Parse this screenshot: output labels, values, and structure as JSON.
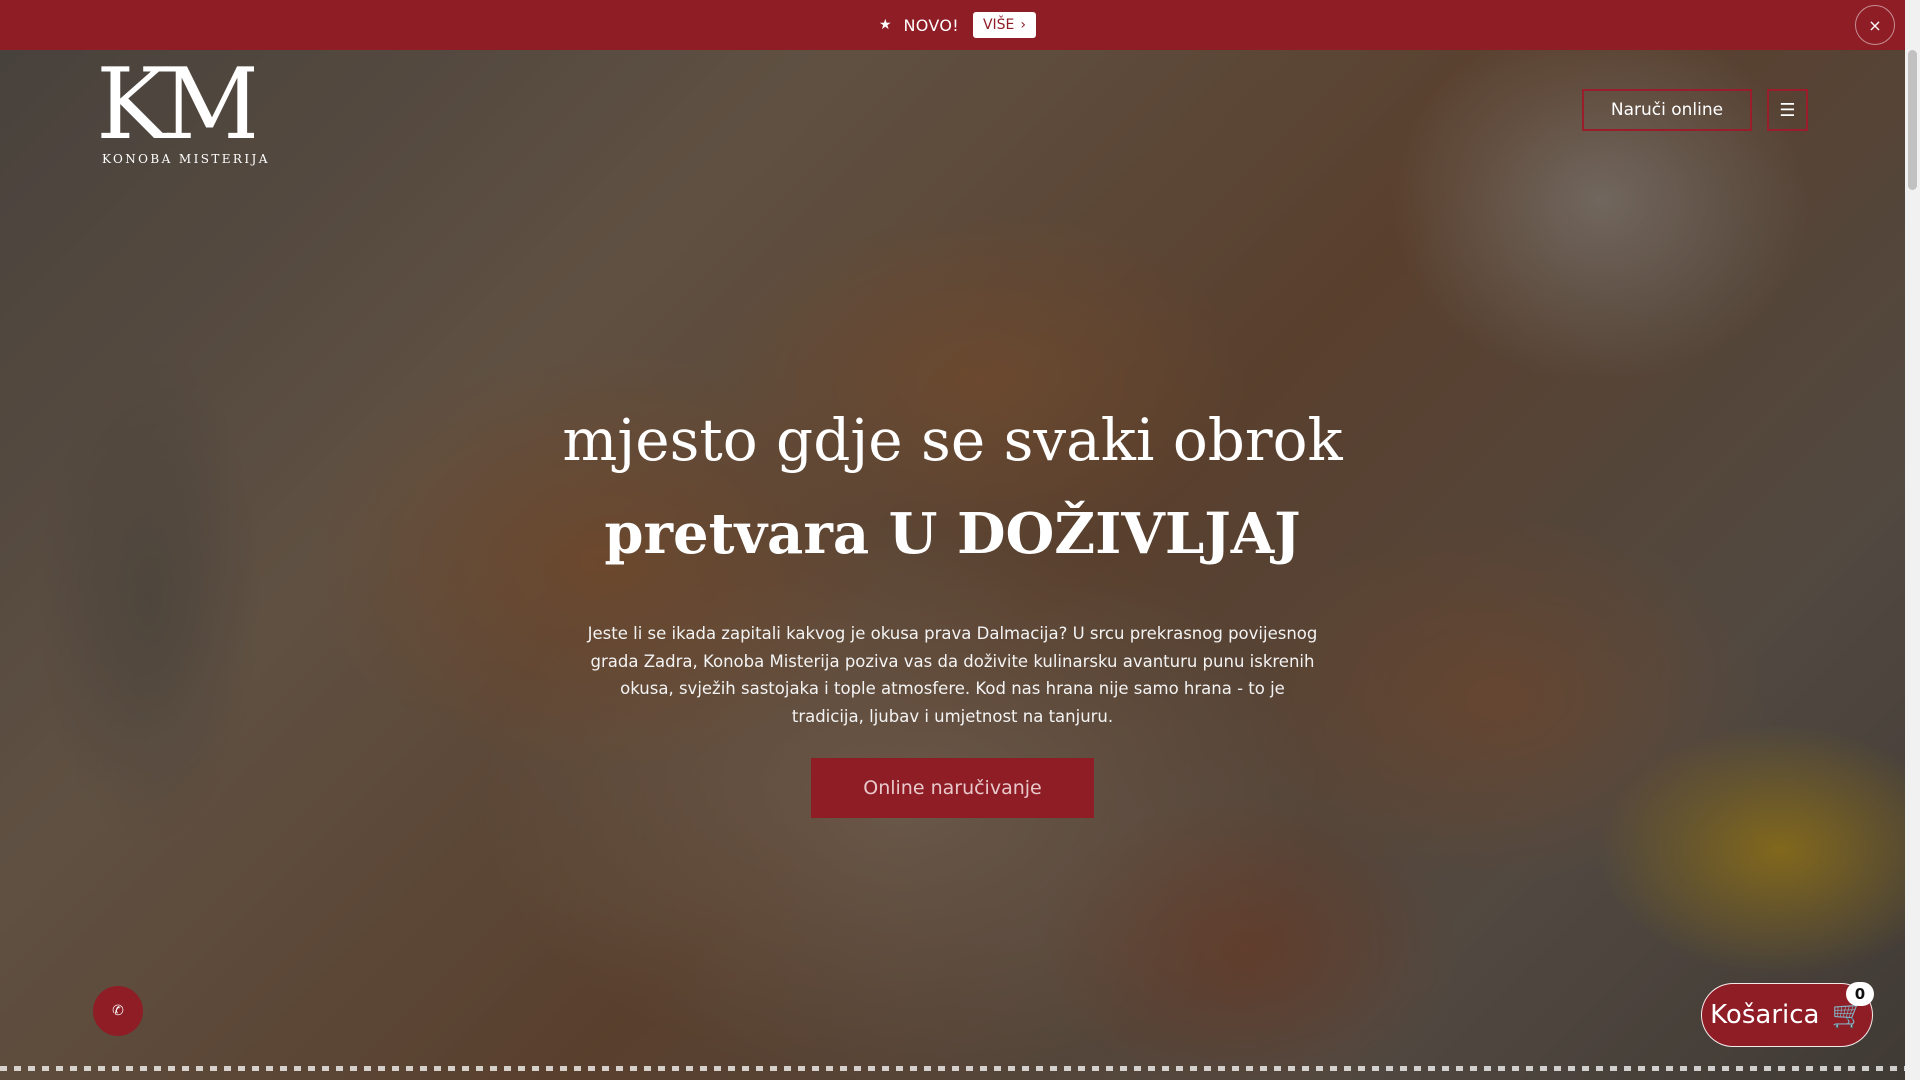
{
  "announcement": {
    "icon": "megaphone-icon",
    "label": "NOVO!",
    "more_label": "VIŠE",
    "close_label": "×"
  },
  "logo": {
    "letters": "KM",
    "tagline": "KONOBA MISTERIJA"
  },
  "header": {
    "order_button": "Naruči online",
    "menu_icon": "menu-icon"
  },
  "hero": {
    "line1": "mjesto gdje se svaki obrok",
    "line2": "pretvara U DOŽIVLJAJ",
    "description": "Jeste li se ikada zapitali kakvog je okusa prava Dalmacija? U srcu prekrasnog povijesnog grada Zadra, Konoba Misterija poziva vas da doživite kulinarsku avanturu punu iskrenih okusa, svježih sastojaka i tople atmosfere. Kod nas hrana nije samo hrana - to je tradicija, ljubav i umjetnost na tanjuru.",
    "cta": "Online naručivanje"
  },
  "cart": {
    "label": "Košarica",
    "count": "0"
  },
  "colors": {
    "brand": "#8f1d26",
    "white": "#ffffff"
  }
}
